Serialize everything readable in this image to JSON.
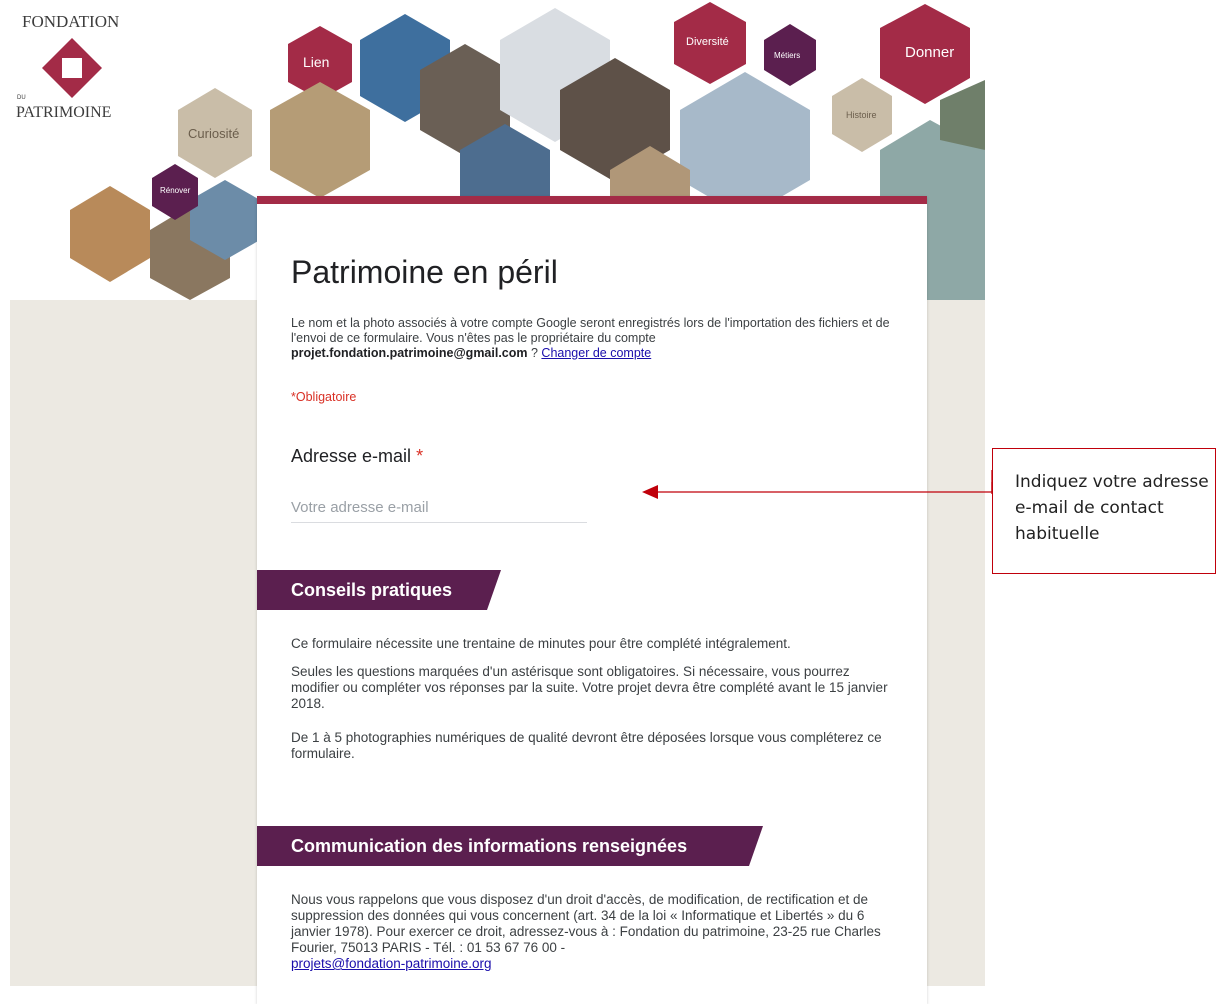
{
  "banner": {
    "logo_top": "FONDATION",
    "logo_du": "DU",
    "logo_bottom": "PATRIMOINE",
    "hex_labels": {
      "lien": "Lien",
      "curiosite": "Curiosité",
      "renover": "Rénover",
      "diversite": "Diversité",
      "metiers": "Métiers",
      "donner": "Donner",
      "histoire": "Histoire"
    },
    "colors": {
      "crimson": "#a32b47",
      "plum": "#5b1f4f",
      "beige": "#c9bda8"
    }
  },
  "form": {
    "title": "Patrimoine en péril",
    "notice_pre": "Le nom et la photo associés à votre compte Google seront enregistrés lors de l'importation des fichiers et de l'envoi de ce formulaire. Vous n'êtes pas le propriétaire du compte",
    "notice_account": "projet.fondation.patrimoine@gmail.com",
    "notice_q": " ? ",
    "notice_link": "Changer de compte",
    "required_note": "*Obligatoire",
    "email_question": "Adresse e-mail",
    "email_star": "*",
    "email_placeholder": "Votre adresse e-mail",
    "sections": {
      "tips_title": "Conseils pratiques",
      "tips_p1": "Ce formulaire nécessite une trentaine de minutes pour être complété intégralement.",
      "tips_p2": "Seules les questions marquées d'un astérisque sont obligatoires. Si nécessaire, vous pourrez modifier ou compléter vos réponses par la suite. Votre projet devra être complété avant le 15 janvier 2018.",
      "tips_p3": "De 1 à 5 photographies numériques de qualité devront être déposées lorsque vous compléterez ce formulaire.",
      "comm_title": "Communication des informations renseignées",
      "comm_p1": "Nous vous rappelons que vous disposez d'un droit d'accès, de modification, de rectification et de suppression des données qui vous concernent (art. 34 de la loi « Informatique et Libertés » du 6 janvier 1978). Pour exercer ce droit, adressez-vous à : Fondation du patrimoine, 23-25 rue Charles Fourier, 75013 PARIS - Tél. : 01 53 67 76 00 -",
      "comm_link": "projets@fondation-patrimoine.org"
    }
  },
  "callout": {
    "text": "Indiquez votre adresse e-mail de contact habituelle",
    "border_color": "#c0000b"
  }
}
